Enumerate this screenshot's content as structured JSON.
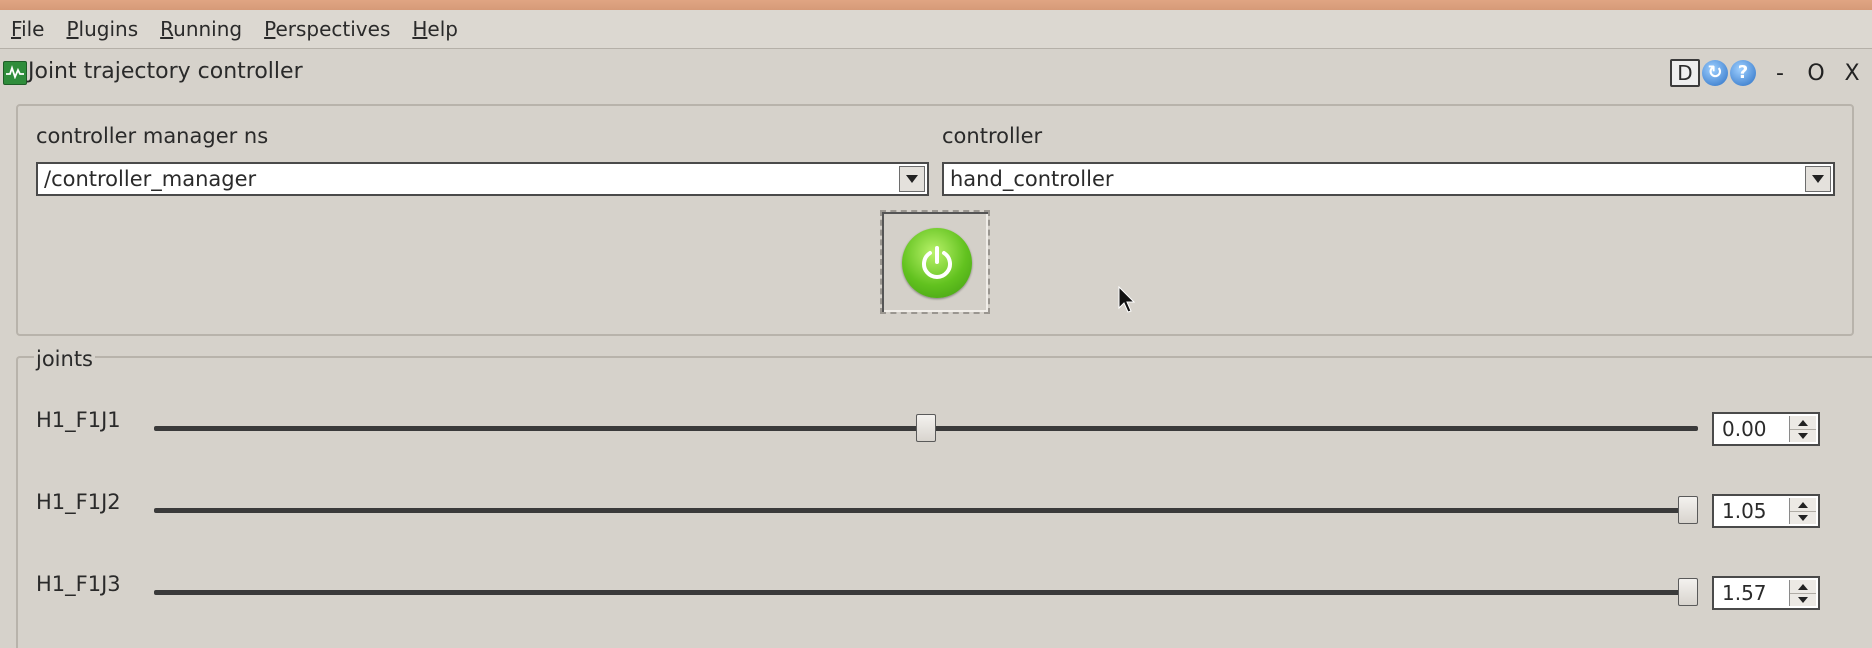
{
  "menubar": {
    "items": [
      {
        "mnemonic": "F",
        "rest": "ile"
      },
      {
        "mnemonic": "P",
        "rest": "lugins"
      },
      {
        "mnemonic": "R",
        "rest": "unning"
      },
      {
        "mnemonic": "P",
        "rest": "erspectives"
      },
      {
        "mnemonic": "H",
        "rest": "elp"
      }
    ]
  },
  "dock": {
    "title": "Joint trajectory controller",
    "d_label": "D",
    "help_label": "?",
    "minimize_label": "-",
    "float_label": "O",
    "close_label": "X"
  },
  "controller_manager": {
    "label": "controller manager ns",
    "value": "/controller_manager"
  },
  "controller": {
    "label": "controller",
    "value": "hand_controller"
  },
  "joints": {
    "title": "joints",
    "rows": [
      {
        "name": "H1_F1J1",
        "value": "0.00",
        "fraction": 0.5
      },
      {
        "name": "H1_F1J2",
        "value": "1.05",
        "fraction": 1.0
      },
      {
        "name": "H1_F1J3",
        "value": "1.57",
        "fraction": 1.0
      }
    ]
  },
  "colors": {
    "background": "#d6d2cb",
    "power_green": "#62c21f",
    "titlebar": "#e0a583"
  }
}
